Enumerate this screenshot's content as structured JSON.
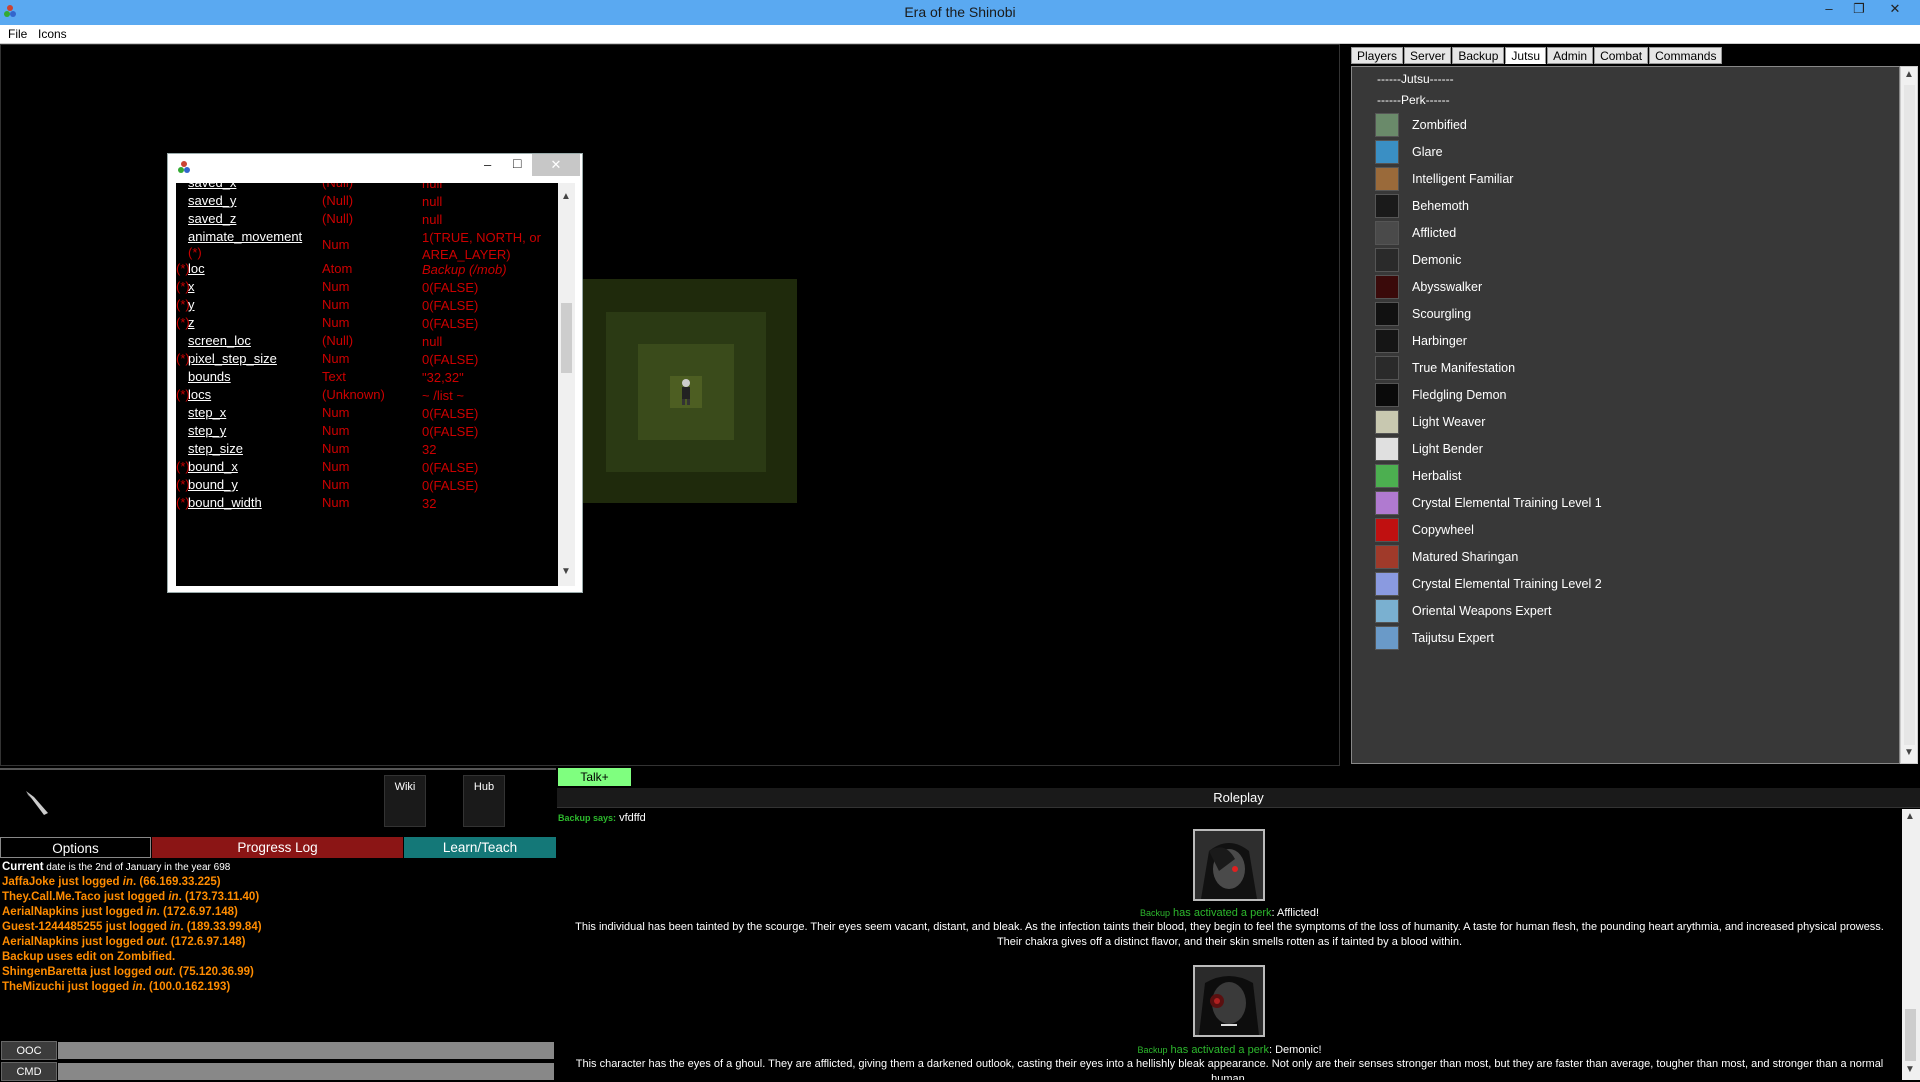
{
  "window": {
    "title": "Era of the Shinobi",
    "minimize": "–",
    "restore": "❐",
    "close": "✕"
  },
  "menu": {
    "file": "File",
    "icons": "Icons"
  },
  "inspector": {
    "minimize": "–",
    "maximize": "□",
    "close": "✕",
    "rows": [
      {
        "name": "saved_x",
        "star": "",
        "type": "(Null)",
        "value": "null"
      },
      {
        "name": "saved_y",
        "star": "",
        "type": "(Null)",
        "value": "null"
      },
      {
        "name": "saved_z",
        "star": "",
        "type": "(Null)",
        "value": "null"
      },
      {
        "name": "animate_movement",
        "star": "(*)",
        "type": "Num",
        "value": "1(TRUE, NORTH, or AREA_LAYER)"
      },
      {
        "name": "loc",
        "star": "(*)",
        "type": "Atom",
        "value": "Backup (/mob)"
      },
      {
        "name": "x",
        "star": "(*)",
        "type": "Num",
        "value": "0(FALSE)"
      },
      {
        "name": "y",
        "star": "(*)",
        "type": "Num",
        "value": "0(FALSE)"
      },
      {
        "name": "z",
        "star": "(*)",
        "type": "Num",
        "value": "0(FALSE)"
      },
      {
        "name": "screen_loc",
        "star": "",
        "type": "(Null)",
        "value": "null"
      },
      {
        "name": "pixel_step_size",
        "star": "(*)",
        "type": "Num",
        "value": "0(FALSE)"
      },
      {
        "name": "bounds",
        "star": "",
        "type": "Text",
        "value": "\"32,32\""
      },
      {
        "name": "locs",
        "star": "(*)",
        "type": "(Unknown)",
        "value": "~ /list ~"
      },
      {
        "name": "step_x",
        "star": "",
        "type": "Num",
        "value": "0(FALSE)"
      },
      {
        "name": "step_y",
        "star": "",
        "type": "Num",
        "value": "0(FALSE)"
      },
      {
        "name": "step_size",
        "star": "",
        "type": "Num",
        "value": "32"
      },
      {
        "name": "bound_x",
        "star": "(*)",
        "type": "Num",
        "value": "0(FALSE)"
      },
      {
        "name": "bound_y",
        "star": "(*)",
        "type": "Num",
        "value": "0(FALSE)"
      },
      {
        "name": "bound_width",
        "star": "(*)",
        "type": "Num",
        "value": "32"
      }
    ]
  },
  "tabs": [
    "Players",
    "Server",
    "Backup",
    "Jutsu",
    "Admin",
    "Combat",
    "Commands"
  ],
  "active_tab": "Jutsu",
  "perk_panel": {
    "jutsu_header": "------Jutsu------",
    "perk_header": "------Perk------",
    "perks": [
      {
        "name": "Zombified",
        "color": "#6a8a6a"
      },
      {
        "name": "Glare",
        "color": "#3a8fc4"
      },
      {
        "name": "Intelligent Familiar",
        "color": "#9a6a3a"
      },
      {
        "name": "Behemoth",
        "color": "#1a1a1a"
      },
      {
        "name": "Afflicted",
        "color": "#4a4a4a"
      },
      {
        "name": "Demonic",
        "color": "#2a2a2a"
      },
      {
        "name": "Abysswalker",
        "color": "#3a0a0a"
      },
      {
        "name": "Scourgling",
        "color": "#111111"
      },
      {
        "name": "Harbinger",
        "color": "#151515"
      },
      {
        "name": "True Manifestation",
        "color": "#2a2a2a"
      },
      {
        "name": "Fledgling Demon",
        "color": "#0a0a0a"
      },
      {
        "name": "Light Weaver",
        "color": "#c8c8b0"
      },
      {
        "name": "Light Bender",
        "color": "#e0e0e0"
      },
      {
        "name": "Herbalist",
        "color": "#4caf50"
      },
      {
        "name": "Crystal Elemental Training Level 1",
        "color": "#b07ad0"
      },
      {
        "name": "Copywheel",
        "color": "#c01010"
      },
      {
        "name": "Matured Sharingan",
        "color": "#a03a2a"
      },
      {
        "name": "Crystal Elemental Training Level 2",
        "color": "#8a9ae0"
      },
      {
        "name": "Oriental Weapons Expert",
        "color": "#7ab0d0"
      },
      {
        "name": "Taijutsu Expert",
        "color": "#6a9ac8"
      }
    ]
  },
  "bottom_left": {
    "wiki": "Wiki",
    "hub": "Hub",
    "options": "Options",
    "progress_log": "Progress Log",
    "learn_teach": "Learn/Teach",
    "date_prefix": "Current",
    "date_text": " date is the 2nd of January in the year 698",
    "log": [
      {
        "pre": "JaffaJoke just logged ",
        "verb": "in",
        "post": ". (66.169.33.225)"
      },
      {
        "pre": "They.Call.Me.Taco just logged ",
        "verb": "in",
        "post": ". (173.73.11.40)"
      },
      {
        "pre": "AerialNapkins just logged ",
        "verb": "in",
        "post": ". (172.6.97.148)"
      },
      {
        "pre": "Guest-1244485255 just logged ",
        "verb": "in",
        "post": ". (189.33.99.84)"
      },
      {
        "pre": "AerialNapkins just logged ",
        "verb": "out",
        "post": ". (172.6.97.148)"
      },
      {
        "pre": "Backup uses edit on Zombified.",
        "verb": "",
        "post": ""
      },
      {
        "pre": "ShingenBaretta just logged ",
        "verb": "out",
        "post": ". (75.120.36.99)"
      },
      {
        "pre": "TheMizuchi just logged ",
        "verb": "in",
        "post": ". (100.0.162.193)"
      }
    ],
    "ooc": "OOC",
    "cmd": "CMD"
  },
  "chat": {
    "tab": "Talk+",
    "header": "Roleplay",
    "say_who": "Backup says:",
    "say_text": " vfdffd",
    "events": [
      {
        "who": "Backup",
        "action": " has activated a perk",
        "perk": ": Afflicted!",
        "text": "This individual has been tainted by the scourge.  Their eyes seem vacant, distant, and bleak.  As the infection taints their blood, they begin to feel the symptoms of the loss of humanity.  A taste for human flesh, the pounding heart arythmia, and increased physical prowess.  Their chakra gives off a distinct flavor, and their skin smells rotten as if tainted by a blood within."
      },
      {
        "who": "Backup",
        "action": " has activated a perk",
        "perk": ": Demonic!",
        "text": "This character has the eyes of a ghoul.  They are afflicted, giving them a darkened outlook, casting their eyes into a hellishly bleak appearance.  Not only are their senses stronger than most, but they are faster than average, tougher than most, and stronger than a normal human."
      }
    ]
  }
}
